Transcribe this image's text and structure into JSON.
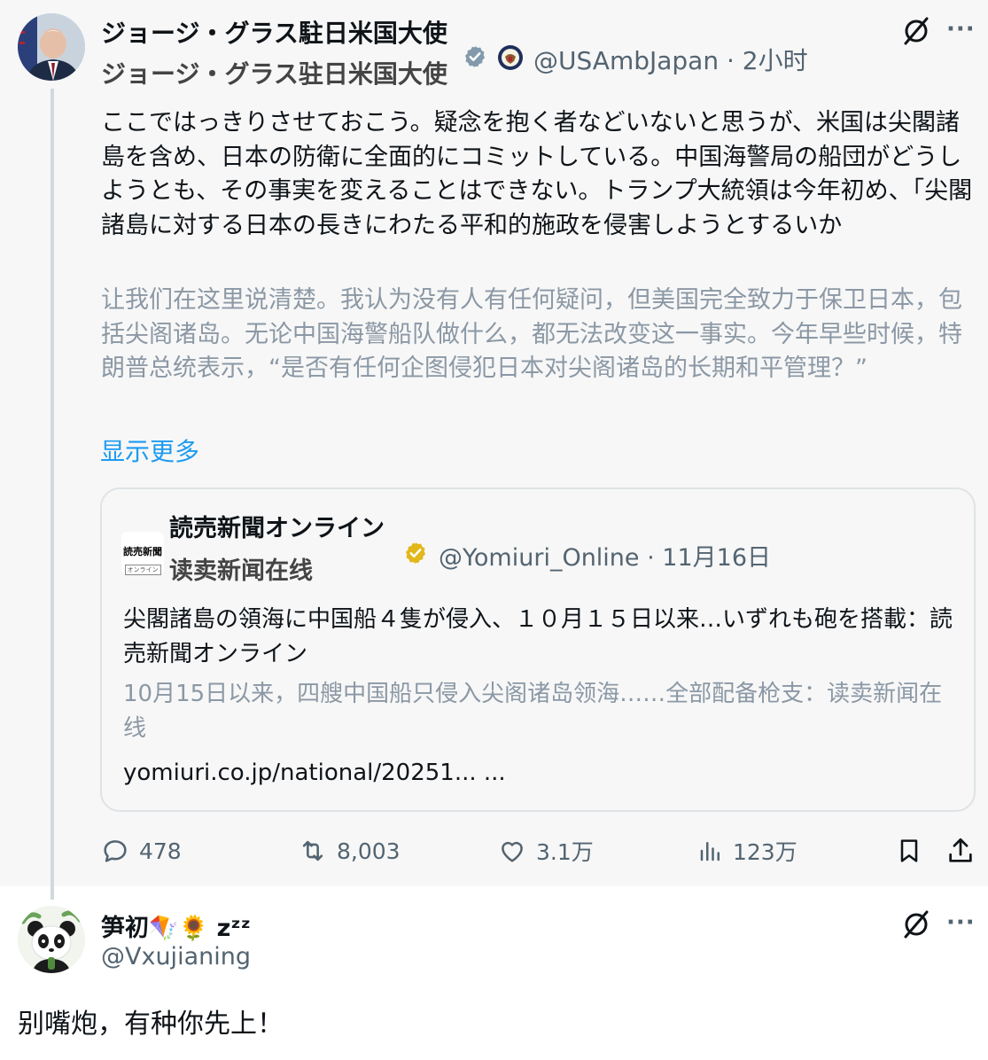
{
  "post": {
    "author_name_jp": "ジョージ・グラス駐日米国大使",
    "author_name_zh": "ジョージ・グラス驻日米国大使",
    "handle": "@USAmbJapan",
    "time": "· 2小时",
    "text_jp": "ここではっきりさせておこう。疑念を抱く者などいないと思うが、米国は尖閣諸島を含め、日本の防衛に全面的にコミットしている。中国海警局の船団がどうしようとも、その事実を変えることはできない。トランプ大統領は今年初め、「尖閣諸島に対する日本の長きにわたる平和的施政を侵害しようとするいか",
    "text_zh": "让我们在这里说清楚。我认为没有人有任何疑问，但美国完全致力于保卫日本，包括尖阁诸岛。无论中国海警船队做什么，都无法改变这一事实。今年早些时候，特朗普总统表示，“是否有任何企图侵犯日本对尖阁诸岛的长期和平管理？”",
    "show_more": "显示更多",
    "quote": {
      "logo_text": "読売新聞",
      "logo_subtext": "オンライン",
      "name_jp": "読売新聞オンライン",
      "name_zh": "读卖新闻在线",
      "handle": "@Yomiuri_Online",
      "time": "· 11月16日",
      "text_jp": "尖閣諸島の領海に中国船４隻が侵入、１０月１５日以来…いずれも砲を搭載：読売新聞オンライン",
      "text_zh": "10月15日以来，四艘中国船只侵入尖阁诸岛领海……全部配备枪支：读卖新闻在线",
      "url": "yomiuri.co.jp/national/20251... ..."
    },
    "actions": {
      "replies": "478",
      "reposts": "8,003",
      "likes": "3.1万",
      "views": "123万"
    }
  },
  "reply": {
    "author_name": "笋初🪁🌻 zᶻᶻ",
    "handle": "@Vxujianing",
    "text": "别嘴炮，有种你先上！"
  },
  "more_label": "···",
  "colors": {
    "accent": "#1d9bf0",
    "verified_blue": "#1d9bf0",
    "verified_gold": "#e2b719",
    "muted": "#536471",
    "translation": "#8b98a5"
  }
}
